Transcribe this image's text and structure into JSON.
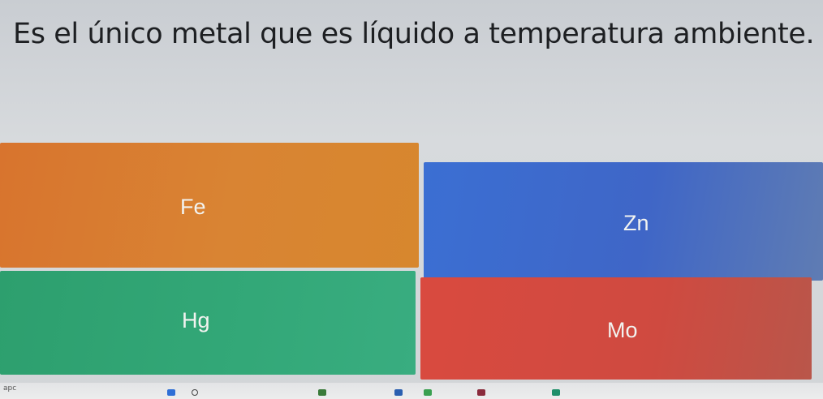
{
  "quiz": {
    "question": "Es el único metal que es líquido a temperatura ambiente.",
    "options": {
      "fe": "Fe",
      "zn": "Zn",
      "hg": "Hg",
      "mo": "Mo"
    }
  },
  "colors": {
    "orange": "#d98433",
    "blue": "#3f66c7",
    "green": "#33a878",
    "red": "#cf4a40"
  },
  "taskbar": {
    "corner_text": "apc",
    "icons": [
      "windows-icon",
      "search-icon",
      "app-icon",
      "app-icon",
      "app-icon",
      "app-icon",
      "app-icon"
    ]
  }
}
